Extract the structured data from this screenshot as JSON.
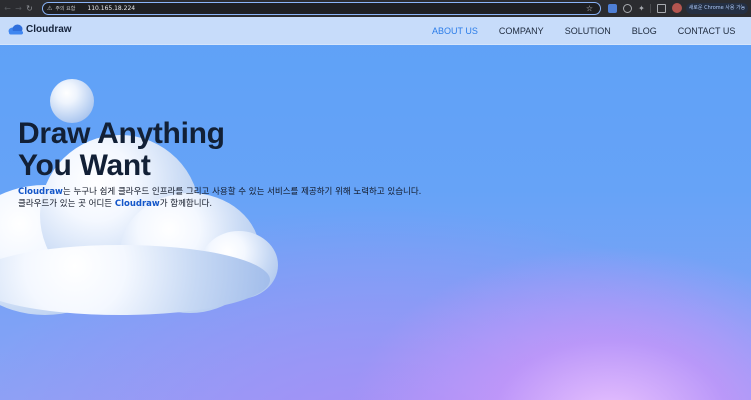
{
  "browser": {
    "security_warning_label": "주의 요함",
    "url": "110.165.18.224",
    "new_chrome_label": "새로운 Chrome 사용 가능"
  },
  "site": {
    "logo_text": "Cloudraw",
    "nav": [
      {
        "label": "ABOUT US",
        "active": true
      },
      {
        "label": "COMPANY",
        "active": false
      },
      {
        "label": "SOLUTION",
        "active": false
      },
      {
        "label": "BLOG",
        "active": false
      },
      {
        "label": "CONTACT US",
        "active": false
      }
    ]
  },
  "hero": {
    "title_line1": "Draw Anything",
    "title_line2": "You Want",
    "line1_brand": "Cloudraw",
    "line1_rest": "는 누구나 쉽게 클라우드 인프라를 그리고 사용할 수 있는 서비스를 제공하기 위해 노력하고 있습니다.",
    "line2_start": "클라우드가 있는 곳 어디든 ",
    "line2_brand": "Cloudraw",
    "line2_end": "가 함께합니다."
  },
  "colors": {
    "accent": "#2b7de9",
    "brand_text": "#1356c9",
    "nav_bg": "#c7dcfa"
  },
  "icons": [
    "back-icon",
    "forward-icon",
    "reload-icon",
    "warning-icon",
    "star-icon",
    "translate-icon",
    "puzzle-icon",
    "cloud-logo-icon"
  ]
}
